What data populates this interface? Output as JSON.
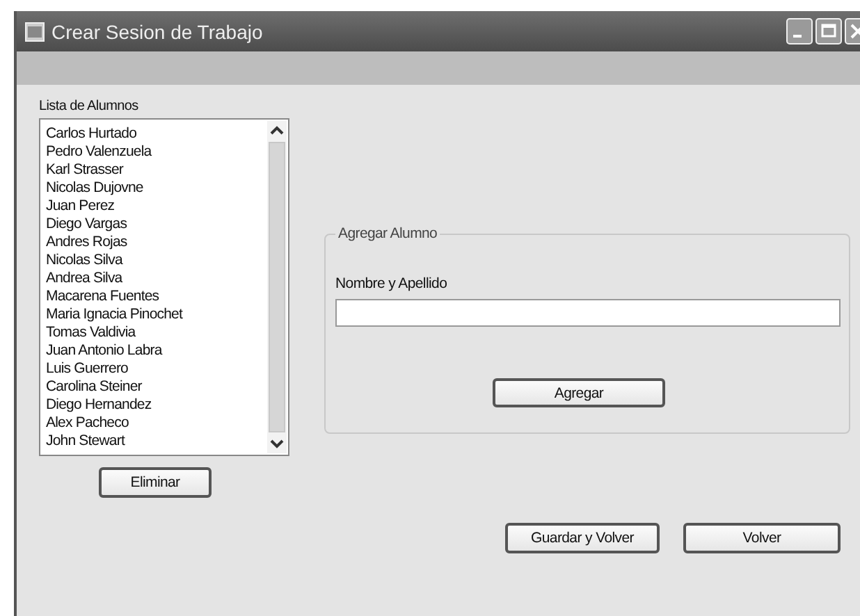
{
  "window": {
    "title": "Crear Sesion de Trabajo"
  },
  "students": {
    "label": "Lista de Alumnos",
    "items": [
      "Carlos Hurtado",
      "Pedro Valenzuela",
      "Karl Strasser",
      "Nicolas Dujovne",
      "Juan Perez",
      "Diego Vargas",
      "Andres Rojas",
      "Nicolas Silva",
      "Andrea Silva",
      "Macarena Fuentes",
      "Maria Ignacia Pinochet",
      "Tomas Valdivia",
      "Juan Antonio Labra",
      "Luis Guerrero",
      "Carolina Steiner",
      "Diego Hernandez",
      "Alex Pacheco",
      "John Stewart"
    ],
    "remove_button": "Eliminar"
  },
  "add_group": {
    "title": "Agregar Alumno",
    "field_label": "Nombre y Apellido",
    "add_button": "Agregar"
  },
  "buttons": [
    "Guardar y Volver",
    "Volver"
  ]
}
